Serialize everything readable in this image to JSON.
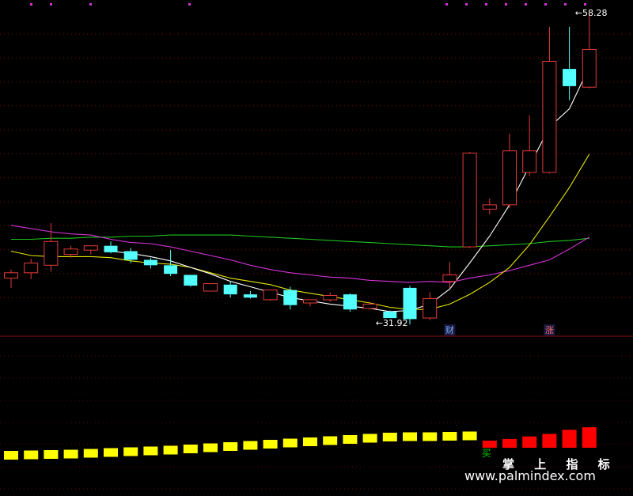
{
  "colors": {
    "up": "#e33a3a",
    "down": "#54ffff",
    "ma_fast": "#ffffff",
    "ma_mid": "#e6e600",
    "ma_slow": "#d633d6",
    "ma_long": "#1ec21e",
    "grid": "#b80000",
    "hist_down": "#ffff00",
    "hist_up": "#ff0000",
    "signal_buy": "#00d000"
  },
  "chart_data": [
    {
      "type": "candlestick",
      "ylim": [
        30.2,
        58.8
      ],
      "grid": true,
      "candles": [
        {
          "o": 33.6,
          "h": 34.4,
          "l": 32.7,
          "c": 34.1
        },
        {
          "o": 34.1,
          "h": 35.4,
          "l": 33.5,
          "c": 35.0
        },
        {
          "o": 34.8,
          "h": 38.7,
          "l": 34.2,
          "c": 37.0
        },
        {
          "o": 35.8,
          "h": 36.6,
          "l": 35.5,
          "c": 36.3
        },
        {
          "o": 36.2,
          "h": 36.6,
          "l": 35.8,
          "c": 36.6
        },
        {
          "o": 36.6,
          "h": 37.0,
          "l": 35.9,
          "c": 36.0
        },
        {
          "o": 36.1,
          "h": 36.4,
          "l": 35.0,
          "c": 35.3
        },
        {
          "o": 35.3,
          "h": 35.5,
          "l": 34.5,
          "c": 34.8
        },
        {
          "o": 34.8,
          "h": 36.2,
          "l": 33.8,
          "c": 34.0
        },
        {
          "o": 33.9,
          "h": 33.9,
          "l": 32.8,
          "c": 32.9
        },
        {
          "o": 32.4,
          "h": 33.1,
          "l": 32.4,
          "c": 33.1
        },
        {
          "o": 33.0,
          "h": 33.3,
          "l": 31.8,
          "c": 32.1
        },
        {
          "o": 32.1,
          "h": 32.4,
          "l": 31.7,
          "c": 31.8
        },
        {
          "o": 31.6,
          "h": 32.5,
          "l": 31.5,
          "c": 32.5
        },
        {
          "o": 32.5,
          "h": 32.8,
          "l": 30.7,
          "c": 31.1
        },
        {
          "o": 31.3,
          "h": 31.6,
          "l": 31.0,
          "c": 31.6
        },
        {
          "o": 31.6,
          "h": 32.3,
          "l": 31.4,
          "c": 32.0
        },
        {
          "o": 32.1,
          "h": 32.2,
          "l": 30.5,
          "c": 30.7
        },
        {
          "o": 30.8,
          "h": 31.4,
          "l": 30.7,
          "c": 31.2
        },
        {
          "o": 30.5,
          "h": 30.6,
          "l": 29.9,
          "c": 29.9
        },
        {
          "o": 32.7,
          "h": 32.9,
          "l": 29.3,
          "c": 29.8
        },
        {
          "o": 29.9,
          "h": 32.3,
          "l": 29.7,
          "c": 31.7
        },
        {
          "o": 33.3,
          "h": 35.1,
          "l": 32.7,
          "c": 33.9
        },
        {
          "o": 36.5,
          "h": 45.3,
          "l": 36.4,
          "c": 45.2
        },
        {
          "o": 40.0,
          "h": 41.0,
          "l": 39.5,
          "c": 40.4
        },
        {
          "o": 40.4,
          "h": 47.0,
          "l": 40.1,
          "c": 45.4
        },
        {
          "o": 43.4,
          "h": 48.7,
          "l": 43.1,
          "c": 45.4
        },
        {
          "o": 43.4,
          "h": 56.9,
          "l": 43.3,
          "c": 53.7
        },
        {
          "o": 53.0,
          "h": 56.9,
          "l": 50.1,
          "c": 51.4
        },
        {
          "o": 51.3,
          "h": 58.28,
          "l": 51.2,
          "c": 54.8
        }
      ],
      "ma_fast": [
        null,
        null,
        null,
        null,
        null,
        36.1,
        35.9,
        35.6,
        35.2,
        34.6,
        34.0,
        33.3,
        32.8,
        32.3,
        31.8,
        31.5,
        31.2,
        31.0,
        30.8,
        30.5,
        30.6,
        31.2,
        32.6,
        35.0,
        37.5,
        40.4,
        44.0,
        47.6,
        49.3,
        53.2
      ],
      "ma_mid": [
        36.1,
        35.7,
        35.6,
        35.6,
        35.6,
        35.5,
        35.2,
        35.0,
        34.9,
        34.6,
        34.1,
        33.6,
        33.3,
        33.0,
        32.5,
        32.2,
        31.9,
        31.6,
        31.3,
        30.9,
        30.7,
        30.7,
        31.2,
        32.1,
        33.2,
        34.6,
        36.7,
        39.3,
        42.0,
        45.1
      ],
      "ma_slow": [
        38.5,
        38.2,
        37.9,
        37.7,
        37.6,
        37.2,
        36.9,
        36.8,
        36.5,
        36.1,
        35.7,
        35.3,
        34.8,
        34.4,
        34.1,
        33.9,
        33.7,
        33.6,
        33.4,
        33.3,
        33.2,
        33.3,
        33.2,
        33.6,
        33.9,
        34.3,
        34.8,
        35.3,
        36.3,
        37.4
      ],
      "ma_long": [
        37.2,
        37.2,
        37.3,
        37.3,
        37.4,
        37.4,
        37.5,
        37.5,
        37.6,
        37.6,
        37.6,
        37.6,
        37.5,
        37.4,
        37.3,
        37.2,
        37.1,
        37.0,
        36.9,
        36.8,
        36.7,
        36.6,
        36.5,
        36.5,
        36.6,
        36.7,
        36.8,
        37.0,
        37.1,
        37.3
      ],
      "annotations": [
        {
          "label": "58.28",
          "index": 29,
          "price": 58.28,
          "side": "right"
        },
        {
          "label": "31.92",
          "index": 19,
          "price": 29.9,
          "side": "right"
        }
      ],
      "markers": [
        {
          "label": "财",
          "index": 22
        },
        {
          "label": "涨",
          "index": 27
        }
      ]
    },
    {
      "type": "bar",
      "title": "掌上指标",
      "values": [
        -50,
        -49,
        -48,
        -47,
        -45,
        -43,
        -41,
        -39,
        -37,
        -34,
        -31,
        -28,
        -25,
        -22,
        -19,
        -16,
        -13,
        -10,
        -7,
        -4,
        -3,
        -3,
        -2,
        -1,
        1,
        3,
        6,
        9,
        14,
        17
      ],
      "ylim": [
        -60,
        25
      ],
      "signals": [
        {
          "label": "买",
          "index": 24
        }
      ]
    }
  ],
  "watermark": {
    "title": "掌 上 指 标",
    "url": "www.palmindex.com"
  }
}
